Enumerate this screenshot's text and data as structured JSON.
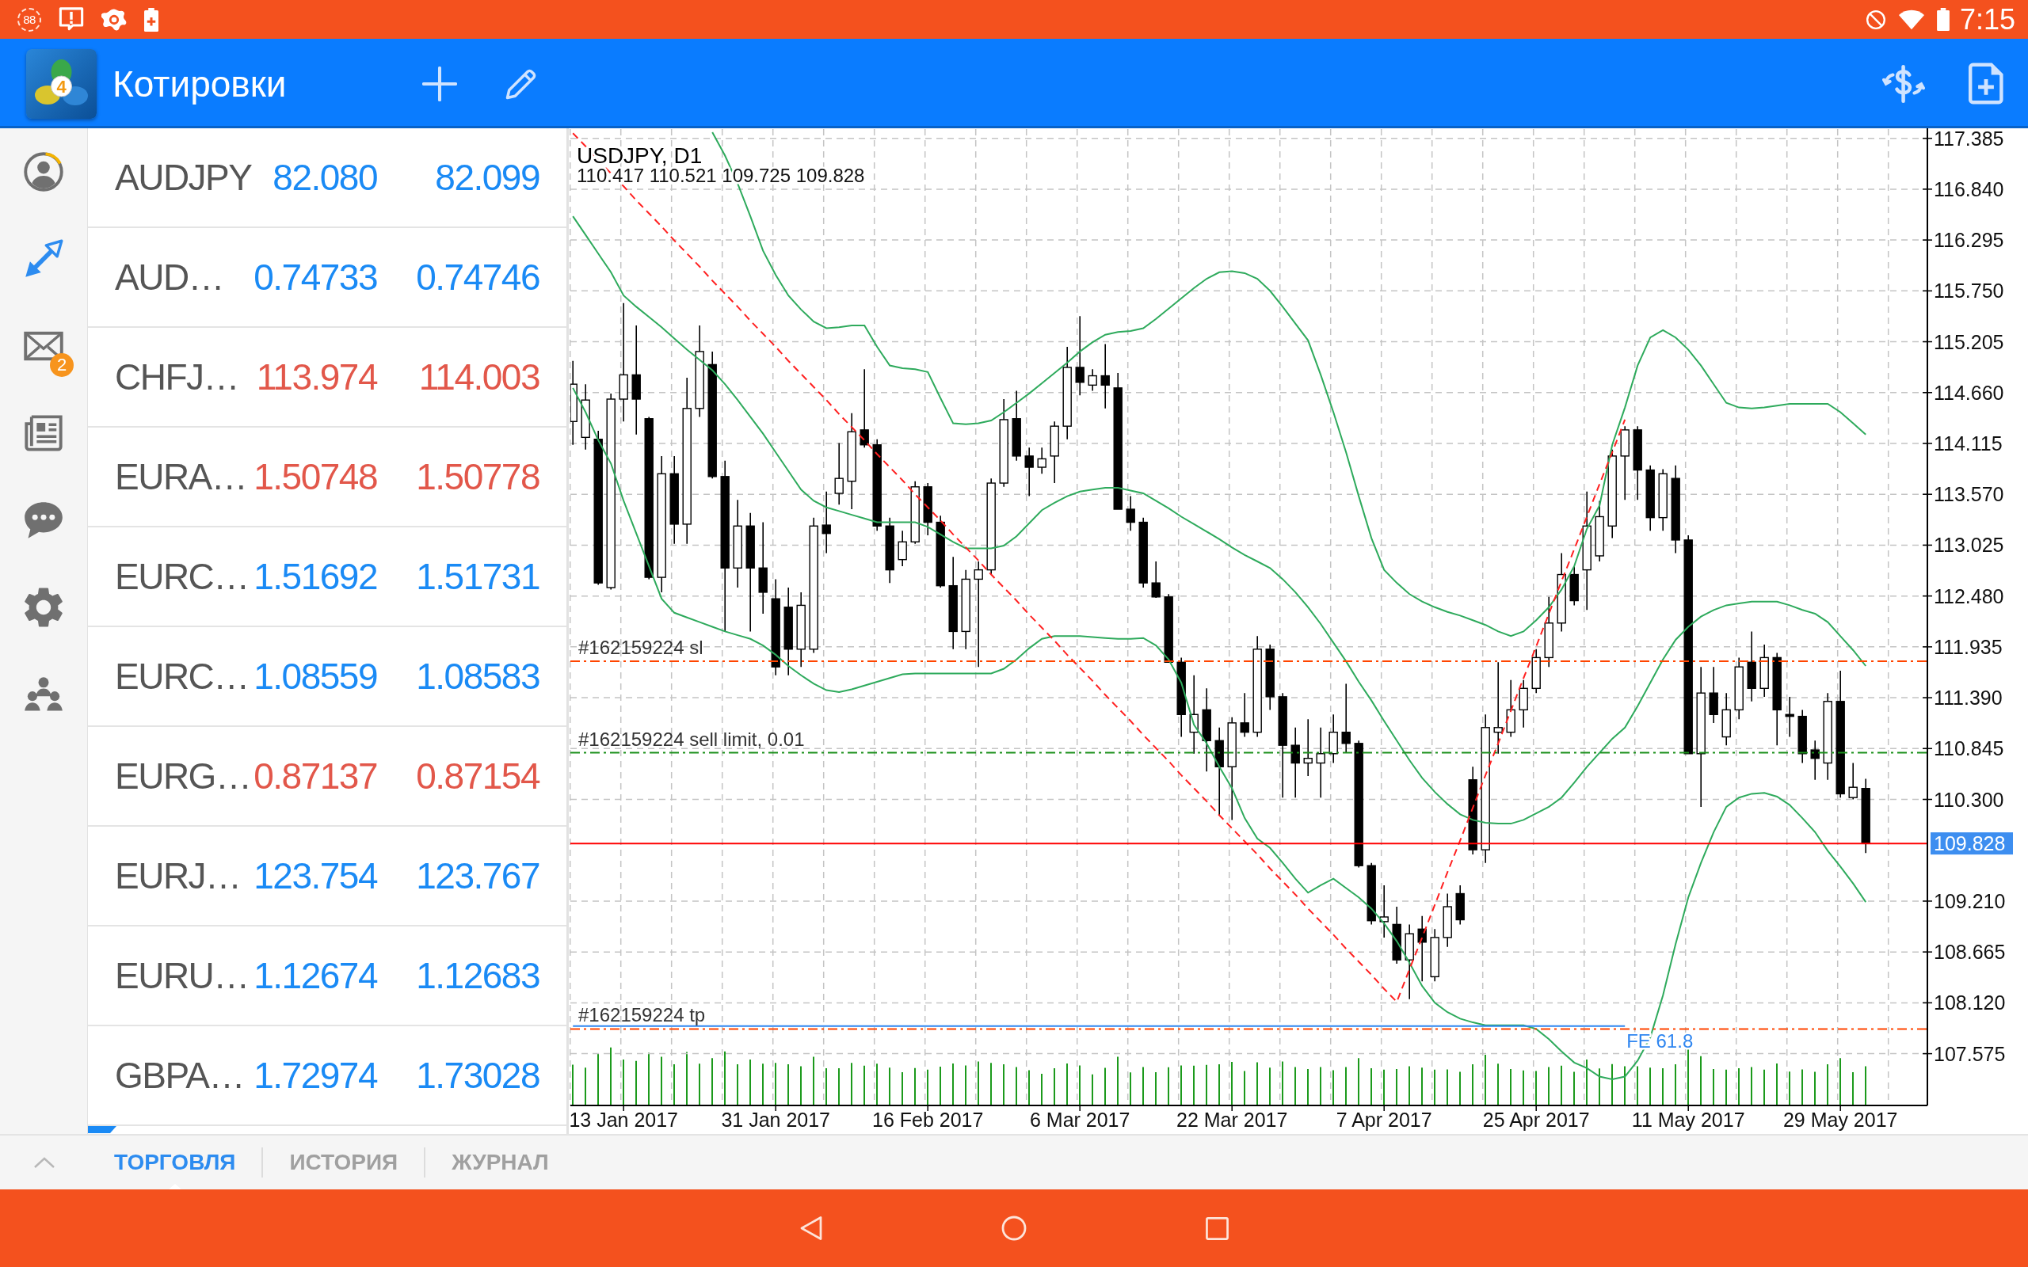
{
  "status_bar": {
    "counter": "88",
    "time": "7:15"
  },
  "app_bar": {
    "logo_digit": "4",
    "title": "Котировки"
  },
  "nav_rail": {
    "items": [
      {
        "selected": false
      },
      {
        "selected": true
      },
      {
        "selected": false,
        "badge": "2"
      },
      {
        "selected": false
      },
      {
        "selected": false
      },
      {
        "selected": false
      },
      {
        "selected": false
      }
    ]
  },
  "quotes": [
    {
      "symbol": "AUDJPY",
      "bid": "82.080",
      "ask": "82.099",
      "color": "#1a8af5"
    },
    {
      "symbol": "AUD…",
      "bid": "0.74733",
      "ask": "0.74746",
      "color": "#1a8af5"
    },
    {
      "symbol": "CHFJ…",
      "bid": "113.974",
      "ask": "114.003",
      "color": "#e2574a"
    },
    {
      "symbol": "EURA…",
      "bid": "1.50748",
      "ask": "1.50778",
      "color": "#e2574a"
    },
    {
      "symbol": "EURC…",
      "bid": "1.51692",
      "ask": "1.51731",
      "color": "#1a8af5"
    },
    {
      "symbol": "EURC…",
      "bid": "1.08559",
      "ask": "1.08583",
      "color": "#1a8af5"
    },
    {
      "symbol": "EURG…",
      "bid": "0.87137",
      "ask": "0.87154",
      "color": "#e2574a"
    },
    {
      "symbol": "EURJ…",
      "bid": "123.754",
      "ask": "123.767",
      "color": "#1a8af5"
    },
    {
      "symbol": "EURU…",
      "bid": "1.12674",
      "ask": "1.12683",
      "color": "#1a8af5"
    },
    {
      "symbol": "GBPA…",
      "bid": "1.72974",
      "ask": "1.73028",
      "color": "#1a8af5"
    }
  ],
  "chart": {
    "chart_data": [
      {
        "type": "candlestick",
        "title": "USDJPY, D1",
        "subtitle": "110.417 110.521 109.725 109.828",
        "grid": true,
        "ylim": [
          107.02,
          117.484
        ],
        "yticks": [
          117.385,
          {
            "value": 116.84,
            "label": "116.840"
          },
          116.295,
          {
            "value": 115.75,
            "label": "115.750"
          },
          115.205,
          {
            "value": 114.66,
            "label": "114.660"
          },
          114.115,
          {
            "value": 113.57,
            "label": "113.570"
          },
          113.025,
          {
            "value": 112.48,
            "label": "112.480"
          },
          111.935,
          {
            "value": 111.39,
            "label": "111.390"
          },
          110.845,
          {
            "value": 110.3,
            "label": "110.300"
          },
          {
            "value": 109.21,
            "label": "109.210"
          },
          108.665,
          {
            "value": 108.12,
            "label": "108.120"
          },
          107.575
        ],
        "categories": [
          null,
          null,
          null,
          null,
          "13 Jan 2017",
          null,
          null,
          null,
          null,
          null,
          null,
          null,
          null,
          null,
          null,
          null,
          "31 Jan 2017",
          null,
          null,
          null,
          null,
          null,
          null,
          null,
          null,
          null,
          null,
          null,
          "16 Feb 2017",
          null,
          null,
          null,
          null,
          null,
          null,
          null,
          null,
          null,
          null,
          null,
          "6 Mar 2017",
          null,
          null,
          null,
          null,
          null,
          null,
          null,
          null,
          null,
          null,
          null,
          "22 Mar 2017",
          null,
          null,
          null,
          null,
          null,
          null,
          null,
          null,
          null,
          null,
          null,
          "7 Apr 2017",
          null,
          null,
          null,
          null,
          null,
          null,
          null,
          null,
          null,
          null,
          null,
          "25 Apr 2017",
          null,
          null,
          null,
          null,
          null,
          null,
          null,
          null,
          null,
          null,
          null,
          "11 May 2017",
          null,
          null,
          null,
          null,
          null,
          null,
          null,
          null,
          null,
          null,
          null,
          "29 May 2017",
          null,
          null
        ],
        "ohlc": [
          [
            114.35,
            115.0,
            114.1,
            114.75
          ],
          [
            114.18,
            114.75,
            114.05,
            114.58
          ],
          [
            114.16,
            114.25,
            112.6,
            112.62
          ],
          [
            112.57,
            114.65,
            112.55,
            114.59
          ],
          [
            114.59,
            115.62,
            114.35,
            114.85
          ],
          [
            114.85,
            115.38,
            114.21,
            114.59
          ],
          [
            114.38,
            114.4,
            112.66,
            112.68
          ],
          [
            112.68,
            113.98,
            112.52,
            113.79
          ],
          [
            113.79,
            113.98,
            113.04,
            113.25
          ],
          [
            113.25,
            114.82,
            113.04,
            114.49
          ],
          [
            114.49,
            115.38,
            114.4,
            115.1
          ],
          [
            114.96,
            115.1,
            113.74,
            113.76
          ],
          [
            113.76,
            113.93,
            112.1,
            112.78
          ],
          [
            112.78,
            113.51,
            112.57,
            113.23
          ],
          [
            113.23,
            113.37,
            112.1,
            112.78
          ],
          [
            112.78,
            113.27,
            112.29,
            112.52
          ],
          [
            112.45,
            112.66,
            111.63,
            111.72
          ],
          [
            112.36,
            112.57,
            111.63,
            111.91
          ],
          [
            111.91,
            112.52,
            111.72,
            112.38
          ],
          [
            111.91,
            113.32,
            111.87,
            113.23
          ],
          [
            113.24,
            113.6,
            112.94,
            113.15
          ],
          [
            113.58,
            114.12,
            113.46,
            113.74
          ],
          [
            113.71,
            114.44,
            113.41,
            114.24
          ],
          [
            114.26,
            114.91,
            114.07,
            114.1
          ],
          [
            114.1,
            114.16,
            113.18,
            113.23
          ],
          [
            113.23,
            113.32,
            112.62,
            112.76
          ],
          [
            112.87,
            113.18,
            112.8,
            113.06
          ],
          [
            113.06,
            113.71,
            113.04,
            113.65
          ],
          [
            113.65,
            113.69,
            113.13,
            113.27
          ],
          [
            113.27,
            113.34,
            112.57,
            112.59
          ],
          [
            112.59,
            112.9,
            111.91,
            112.1
          ],
          [
            112.1,
            112.76,
            111.91,
            112.66
          ],
          [
            112.66,
            112.85,
            111.72,
            112.76
          ],
          [
            112.76,
            113.74,
            112.71,
            113.69
          ],
          [
            113.69,
            114.59,
            113.65,
            114.37
          ],
          [
            114.38,
            114.68,
            113.93,
            113.98
          ],
          [
            113.98,
            114.07,
            113.55,
            113.86
          ],
          [
            113.86,
            114.07,
            113.79,
            113.95
          ],
          [
            113.98,
            114.35,
            113.69,
            114.3
          ],
          [
            114.3,
            115.15,
            114.16,
            114.93
          ],
          [
            114.93,
            115.48,
            114.63,
            114.77
          ],
          [
            114.74,
            114.91,
            114.68,
            114.84
          ],
          [
            114.84,
            115.18,
            114.49,
            114.74
          ],
          [
            114.71,
            114.87,
            113.41,
            113.41
          ],
          [
            113.41,
            113.55,
            113.18,
            113.27
          ],
          [
            113.27,
            113.32,
            112.57,
            112.62
          ],
          [
            112.62,
            112.85,
            112.46,
            112.47
          ],
          [
            112.47,
            112.5,
            111.77,
            111.77
          ],
          [
            111.77,
            111.82,
            110.97,
            111.21
          ],
          [
            111.02,
            111.63,
            110.79,
            111.21
          ],
          [
            111.26,
            111.49,
            110.6,
            110.93
          ],
          [
            110.93,
            111.07,
            110.13,
            110.65
          ],
          [
            110.65,
            111.18,
            110.08,
            111.12
          ],
          [
            111.12,
            111.44,
            110.97,
            111.02
          ],
          [
            111.02,
            112.05,
            110.97,
            111.91
          ],
          [
            111.91,
            111.96,
            111.26,
            111.4
          ],
          [
            111.4,
            111.44,
            110.32,
            110.88
          ],
          [
            110.88,
            111.07,
            110.32,
            110.69
          ],
          [
            110.69,
            111.16,
            110.55,
            110.74
          ],
          [
            110.69,
            111.07,
            110.32,
            110.79
          ],
          [
            110.79,
            111.21,
            110.69,
            111.02
          ],
          [
            111.02,
            111.54,
            110.8,
            110.9
          ],
          [
            110.9,
            110.93,
            109.57,
            109.59
          ],
          [
            109.59,
            109.62,
            108.96,
            109.0
          ],
          [
            108.99,
            109.38,
            108.82,
            109.04
          ],
          [
            108.96,
            109.15,
            108.54,
            108.58
          ],
          [
            108.58,
            108.96,
            108.16,
            108.86
          ],
          [
            108.91,
            109.05,
            108.35,
            108.77
          ],
          [
            108.4,
            108.91,
            108.35,
            108.82
          ],
          [
            108.82,
            109.29,
            108.72,
            109.15
          ],
          [
            109.29,
            109.38,
            108.96,
            109.01
          ],
          [
            110.51,
            110.65,
            109.71,
            109.76
          ],
          [
            109.76,
            111.21,
            109.62,
            111.07
          ],
          [
            111.02,
            111.77,
            110.79,
            111.07
          ],
          [
            111.02,
            111.58,
            110.97,
            111.26
          ],
          [
            111.26,
            111.58,
            111.07,
            111.49
          ],
          [
            111.49,
            111.91,
            111.44,
            111.82
          ],
          [
            111.82,
            112.47,
            111.72,
            112.19
          ],
          [
            112.19,
            112.94,
            112.1,
            112.71
          ],
          [
            112.71,
            112.8,
            112.38,
            112.43
          ],
          [
            112.76,
            113.6,
            112.33,
            113.23
          ],
          [
            112.91,
            113.5,
            112.85,
            113.33
          ],
          [
            113.23,
            114.05,
            113.1,
            113.98
          ],
          [
            113.98,
            114.3,
            113.51,
            114.26
          ],
          [
            114.26,
            114.3,
            113.51,
            113.83
          ],
          [
            113.83,
            113.88,
            113.18,
            113.32
          ],
          [
            113.32,
            113.84,
            113.18,
            113.79
          ],
          [
            113.74,
            113.88,
            112.94,
            113.08
          ],
          [
            113.08,
            113.13,
            110.79,
            110.79
          ],
          [
            110.79,
            111.72,
            110.22,
            111.44
          ],
          [
            111.44,
            111.72,
            111.12,
            111.21
          ],
          [
            110.97,
            111.44,
            110.88,
            111.26
          ],
          [
            111.26,
            111.82,
            111.16,
            111.72
          ],
          [
            111.77,
            112.1,
            111.35,
            111.49
          ],
          [
            111.49,
            111.96,
            111.4,
            111.82
          ],
          [
            111.82,
            111.87,
            110.88,
            111.26
          ],
          [
            111.21,
            111.4,
            110.97,
            111.19
          ],
          [
            111.19,
            111.26,
            110.69,
            110.79
          ],
          [
            110.83,
            110.93,
            110.51,
            110.74
          ],
          [
            110.69,
            111.44,
            110.51,
            111.35
          ],
          [
            111.35,
            111.68,
            110.32,
            110.36
          ],
          [
            110.32,
            110.69,
            110.3,
            110.43
          ],
          [
            110.417,
            110.521,
            109.725,
            109.828
          ]
        ],
        "series": [
          {
            "type": "line",
            "color": "#2eaa5c",
            "values": [
              null,
              null,
              null,
              null,
              null,
              null,
              null,
              null,
              null,
              null,
              null,
              117.45,
              117.2,
              116.9,
              116.55,
              116.18,
              115.92,
              115.7,
              115.55,
              115.42,
              115.35,
              115.36,
              115.38,
              115.38,
              115.15,
              114.95,
              114.92,
              114.91,
              114.88,
              114.6,
              114.33,
              114.32,
              114.33,
              114.36,
              114.45,
              114.55,
              114.65,
              114.76,
              114.87,
              114.98,
              115.1,
              115.2,
              115.28,
              115.31,
              115.32,
              115.35,
              115.45,
              115.56,
              115.67,
              115.78,
              115.88,
              115.95,
              115.96,
              115.94,
              115.88,
              115.75,
              115.58,
              115.4,
              115.22,
              114.85,
              114.45,
              114.02,
              113.55,
              113.1,
              112.76,
              112.62,
              112.5,
              112.42,
              112.36,
              112.31,
              112.27,
              112.22,
              112.17,
              112.1,
              112.05,
              112.1,
              112.22,
              112.36,
              112.55,
              112.8,
              113.2,
              113.45,
              114.1,
              114.5,
              114.95,
              115.25,
              115.33,
              115.25,
              115.12,
              114.95,
              114.75,
              114.55,
              114.5,
              114.49,
              114.5,
              114.52,
              114.54,
              114.54,
              114.54,
              114.54,
              114.45,
              114.33,
              114.21
            ]
          },
          {
            "type": "line",
            "color": "#2eaa5c",
            "values": [
              116.55,
              116.35,
              116.15,
              115.95,
              115.7,
              115.58,
              115.47,
              115.36,
              115.24,
              115.12,
              115.01,
              114.9,
              114.75,
              114.58,
              114.4,
              114.22,
              114.02,
              113.82,
              113.62,
              113.5,
              113.43,
              113.39,
              113.35,
              113.31,
              113.27,
              113.27,
              113.27,
              113.27,
              113.22,
              113.14,
              113.06,
              112.99,
              112.99,
              112.99,
              113.02,
              113.12,
              113.26,
              113.4,
              113.48,
              113.55,
              113.6,
              113.62,
              113.64,
              113.64,
              113.61,
              113.58,
              113.5,
              113.42,
              113.33,
              113.25,
              113.17,
              113.09,
              113.0,
              112.92,
              112.85,
              112.78,
              112.66,
              112.52,
              112.36,
              112.18,
              111.98,
              111.78,
              111.56,
              111.36,
              111.14,
              110.93,
              110.72,
              110.53,
              110.38,
              110.25,
              110.14,
              110.08,
              110.05,
              110.04,
              110.04,
              110.08,
              110.15,
              110.22,
              110.32,
              110.48,
              110.65,
              110.8,
              110.95,
              111.07,
              111.3,
              111.55,
              111.8,
              112.01,
              112.15,
              112.26,
              112.33,
              112.38,
              112.4,
              112.42,
              112.42,
              112.42,
              112.38,
              112.33,
              112.29,
              112.2,
              112.05,
              111.9,
              111.73
            ]
          },
          {
            "type": "line",
            "color": "#2eaa5c",
            "values": [
              114.71,
              114.45,
              114.15,
              113.9,
              113.5,
              113.15,
              112.8,
              112.45,
              112.3,
              112.25,
              112.2,
              112.15,
              112.1,
              112.06,
              112.02,
              111.95,
              111.85,
              111.73,
              111.63,
              111.54,
              111.47,
              111.45,
              111.48,
              111.52,
              111.56,
              111.6,
              111.64,
              111.65,
              111.65,
              111.65,
              111.65,
              111.65,
              111.65,
              111.65,
              111.7,
              111.8,
              111.92,
              112.02,
              112.05,
              112.05,
              112.05,
              112.04,
              112.03,
              112.02,
              112.02,
              112.03,
              111.95,
              111.8,
              111.55,
              111.1,
              110.9,
              110.65,
              110.42,
              110.1,
              109.88,
              109.78,
              109.62,
              109.45,
              109.3,
              109.38,
              109.45,
              109.35,
              109.25,
              109.13,
              108.97,
              108.78,
              108.55,
              108.3,
              108.12,
              108.02,
              107.95,
              107.91,
              107.88,
              107.88,
              107.88,
              107.88,
              107.84,
              107.73,
              107.6,
              107.48,
              107.42,
              107.33,
              107.3,
              107.33,
              107.5,
              107.75,
              108.2,
              108.75,
              109.25,
              109.62,
              109.95,
              110.22,
              110.32,
              110.36,
              110.37,
              110.33,
              110.24,
              110.1,
              109.95,
              109.75,
              109.58,
              109.4,
              109.2
            ]
          },
          {
            "type": "line",
            "color": "#ff2020",
            "line_style": "dashed",
            "values": [
              117.44,
              117.3,
              117.15,
              117.01,
              116.87,
              116.72,
              116.58,
              116.44,
              116.29,
              116.15,
              116.01,
              115.86,
              115.72,
              115.58,
              115.43,
              115.29,
              115.15,
              115.0,
              114.86,
              114.72,
              114.58,
              114.43,
              114.29,
              114.15,
              114.0,
              113.86,
              113.72,
              113.57,
              113.43,
              113.29,
              113.14,
              113.0,
              112.86,
              112.71,
              112.57,
              112.43,
              112.28,
              112.14,
              112.0,
              111.85,
              111.71,
              111.57,
              111.42,
              111.28,
              111.14,
              110.99,
              110.85,
              110.71,
              110.56,
              110.42,
              110.28,
              110.13,
              109.99,
              109.85,
              109.71,
              109.56,
              109.42,
              109.28,
              109.13,
              108.99,
              108.85,
              108.7,
              108.56,
              108.42,
              108.27,
              108.13,
              108.48,
              108.82,
              109.17,
              109.52,
              109.86,
              110.21,
              110.56,
              110.9,
              111.25,
              111.6,
              111.94,
              112.29,
              112.64,
              112.98,
              113.33,
              113.68,
              114.02,
              114.37,
              null,
              null,
              null,
              null,
              null,
              null,
              null,
              null,
              null,
              null,
              null,
              null,
              null,
              null,
              null,
              null,
              null,
              null,
              null
            ]
          },
          {
            "type": "line",
            "name": "FE 61.8",
            "color": "#2f86f0",
            "values": [
              107.87,
              107.87,
              107.87,
              107.87,
              107.87,
              107.87,
              107.87,
              107.87,
              107.87,
              107.87,
              107.87,
              107.87,
              107.87,
              107.87,
              107.87,
              107.87,
              107.87,
              107.87,
              107.87,
              107.87,
              107.87,
              107.87,
              107.87,
              107.87,
              107.87,
              107.87,
              107.87,
              107.87,
              107.87,
              107.87,
              107.87,
              107.87,
              107.87,
              107.87,
              107.87,
              107.87,
              107.87,
              107.87,
              107.87,
              107.87,
              107.87,
              107.87,
              107.87,
              107.87,
              107.87,
              107.87,
              107.87,
              107.87,
              107.87,
              107.87,
              107.87,
              107.87,
              107.87,
              107.87,
              107.87,
              107.87,
              107.87,
              107.87,
              107.87,
              107.87,
              107.87,
              107.87,
              107.87,
              107.87,
              107.87,
              107.87,
              107.87,
              107.87,
              107.87,
              107.87,
              107.87,
              107.87,
              107.87,
              107.87,
              107.87,
              107.87,
              107.87,
              107.87,
              107.87,
              107.87,
              107.87,
              107.87,
              107.87,
              107.87,
              null,
              null,
              null,
              null,
              null,
              null,
              null,
              null,
              null,
              null,
              null,
              null,
              null,
              null,
              null,
              null,
              null,
              null,
              null
            ]
          }
        ],
        "ref_lines": [
          {
            "axis": "y",
            "value": 111.78,
            "label": "#162159224 sl",
            "color": "#ff4500",
            "line_style": "dashdot"
          },
          {
            "axis": "y",
            "value": 110.8,
            "label": "#162159224 sell limit, 0.01",
            "color": "#1a8f1a",
            "line_style": "dashdot"
          },
          {
            "axis": "y",
            "value": 109.828,
            "label": "109.828",
            "color": "#ff0000",
            "line_style": "solid"
          },
          {
            "axis": "y",
            "value": 107.84,
            "label": "#162159224 tp",
            "color": "#ff4500",
            "line_style": "dashdot"
          }
        ]
      }
    ]
  },
  "bottom_tabs": [
    {
      "label": "ТОРГОВЛЯ",
      "selected": true
    },
    {
      "label": "ИСТОРИЯ",
      "selected": false
    },
    {
      "label": "ЖУРНАЛ",
      "selected": false
    }
  ]
}
